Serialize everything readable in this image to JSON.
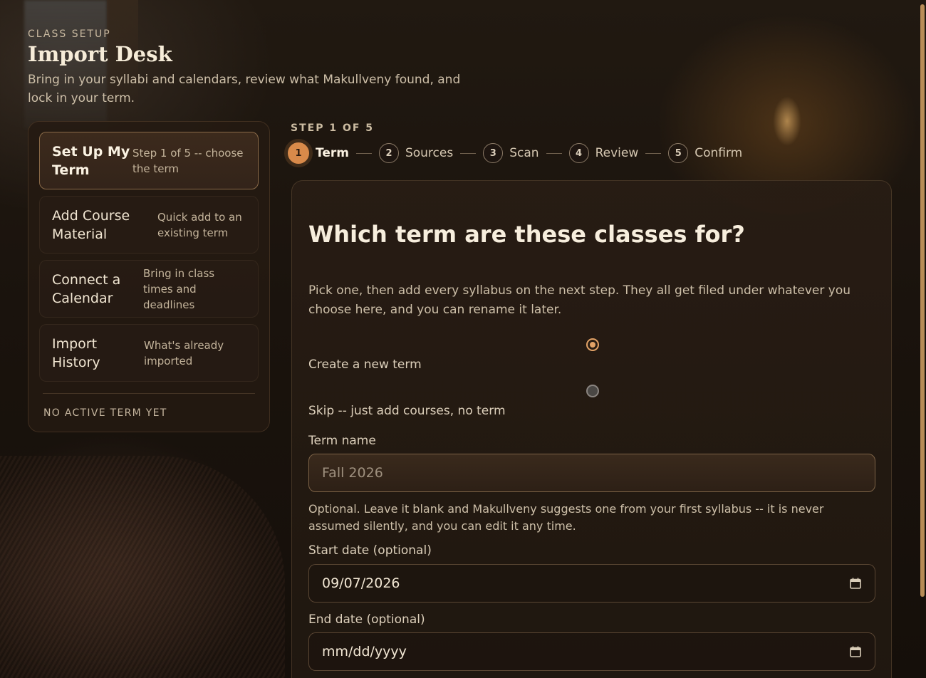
{
  "header": {
    "eyebrow": "CLASS SETUP",
    "title": "Import Desk",
    "subtitle": "Bring in your syllabi and calendars, review what Makullveny found, and lock in your term."
  },
  "sidebar": {
    "items": [
      {
        "label": "Set Up My Term",
        "desc": "Step 1 of 5 -- choose the term",
        "active": true
      },
      {
        "label": "Add Course Material",
        "desc": "Quick add to an existing term",
        "active": false
      },
      {
        "label": "Connect a Calendar",
        "desc": "Bring in class times and deadlines",
        "active": false
      },
      {
        "label": "Import History",
        "desc": "What's already imported",
        "active": false
      }
    ],
    "status": "NO ACTIVE TERM YET"
  },
  "stepper": {
    "count": "STEP 1 OF 5",
    "steps": [
      {
        "num": "1",
        "label": "Term",
        "active": true
      },
      {
        "num": "2",
        "label": "Sources",
        "active": false
      },
      {
        "num": "3",
        "label": "Scan",
        "active": false
      },
      {
        "num": "4",
        "label": "Review",
        "active": false
      },
      {
        "num": "5",
        "label": "Confirm",
        "active": false
      }
    ]
  },
  "form": {
    "heading": "Which term are these classes for?",
    "intro": "Pick one, then add every syllabus on the next step. They all get filed under whatever you choose here, and you can rename it later.",
    "options": [
      {
        "label": "Create a new term",
        "checked": true
      },
      {
        "label": "Skip -- just add courses, no term",
        "checked": false
      }
    ],
    "term_name_label": "Term name",
    "term_name_placeholder": "Fall 2026",
    "term_help": "Optional. Leave it blank and Makullveny suggests one from your first syllabus -- it is never assumed silently, and you can edit it any time.",
    "start_label": "Start date (optional)",
    "start_value": "09/07/2026",
    "end_label": "End date (optional)",
    "end_value": "mm/dd/yyyy"
  },
  "icons": {
    "date_picker": "calendar-icon"
  },
  "colors": {
    "accent": "#d88a4a",
    "background": "#1a130d",
    "card": "#281d14"
  }
}
